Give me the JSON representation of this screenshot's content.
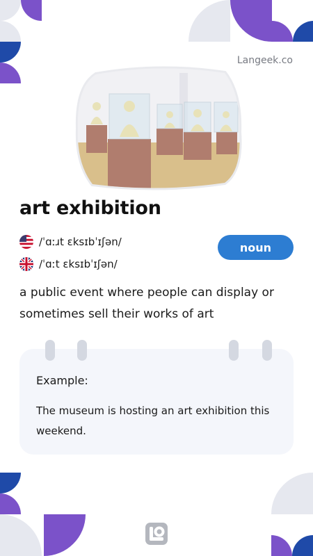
{
  "brand": {
    "site": "Langeek.co"
  },
  "entry": {
    "word": "art exhibition",
    "part_of_speech": "noun",
    "pronunciations": [
      {
        "region": "us",
        "flag_icon": "us-flag-icon",
        "ipa": "/ˈɑːɹt ɛksɪbˈɪʃən/"
      },
      {
        "region": "uk",
        "flag_icon": "uk-flag-icon",
        "ipa": "/ˈɑːt ɛksɪbˈɪʃən/"
      }
    ],
    "definition": "a public event where people can display or sometimes sell their works of art"
  },
  "example": {
    "label": "Example:",
    "text": "The museum is hosting an art exhibition this weekend."
  },
  "illustration": {
    "icon": "gallery-sculptures-illustration"
  },
  "colors": {
    "accent_blue": "#2d7dd2",
    "purple": "#7b52c9",
    "navy": "#1f4aa8",
    "light_gray": "#e6e8ef",
    "card_bg": "#f4f6fb"
  }
}
